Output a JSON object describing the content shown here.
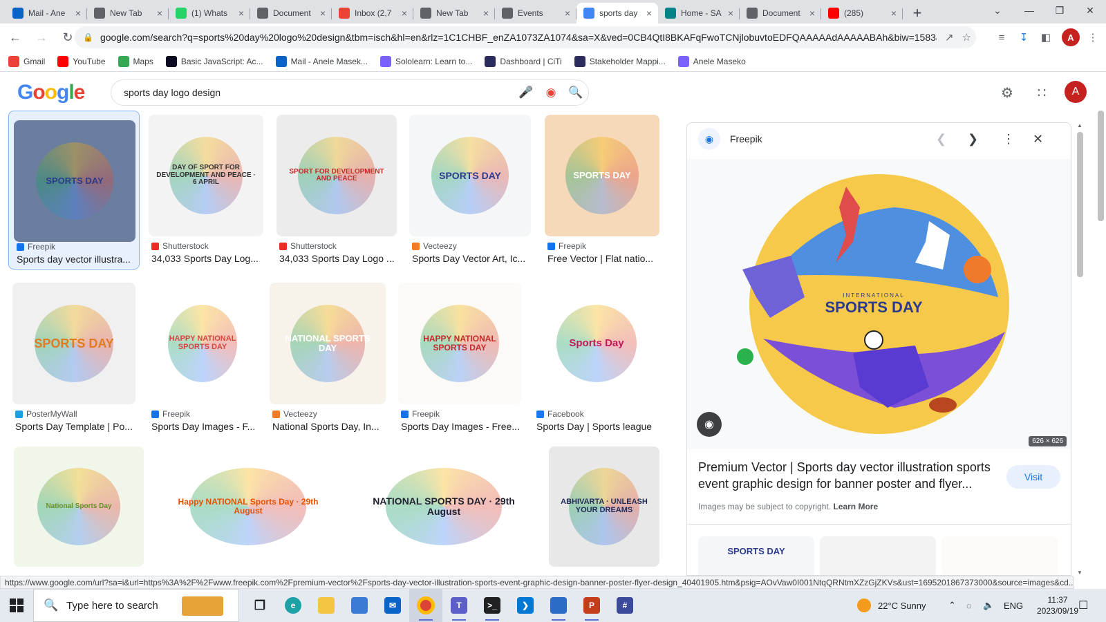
{
  "tabs": [
    {
      "label": "Mail - Ane",
      "icon": "outlook-icon",
      "color": "#0a64c8"
    },
    {
      "label": "New Tab",
      "icon": "chrome-icon",
      "color": "#5f6368"
    },
    {
      "label": "(1) Whats",
      "icon": "whatsapp-icon",
      "color": "#25d366"
    },
    {
      "label": "Document",
      "icon": "globe-icon",
      "color": "#5f6368"
    },
    {
      "label": "Inbox (2,7",
      "icon": "gmail-icon",
      "color": "#ea4335"
    },
    {
      "label": "New Tab",
      "icon": "chrome-icon",
      "color": "#5f6368"
    },
    {
      "label": "Events",
      "icon": "globe-icon",
      "color": "#5f6368"
    },
    {
      "label": "sports day",
      "icon": "google-icon",
      "color": "#4285f4",
      "active": true
    },
    {
      "label": "Home - SA",
      "icon": "sharepoint-icon",
      "color": "#038387"
    },
    {
      "label": "Document",
      "icon": "globe-icon",
      "color": "#5f6368"
    },
    {
      "label": "(285)",
      "icon": "youtube-icon",
      "color": "#ff0000"
    }
  ],
  "address": {
    "url": "google.com/search?q=sports%20day%20logo%20design&tbm=isch&hl=en&rlz=1C1CHBF_enZA1073ZA1074&sa=X&ved=0CB4QtI8BKAFqFwoTCNjlobuvtoEDFQAAAAAdAAAAABAh&biw=1583&..."
  },
  "bookmarks": [
    {
      "label": "Gmail",
      "icon": "gmail-icon",
      "color": "#ea4335"
    },
    {
      "label": "YouTube",
      "icon": "youtube-icon",
      "color": "#ff0000"
    },
    {
      "label": "Maps",
      "icon": "maps-icon",
      "color": "#34a853"
    },
    {
      "label": "Basic JavaScript: Ac...",
      "icon": "freecodecamp-icon",
      "color": "#0a0a23"
    },
    {
      "label": "Mail - Anele Masek...",
      "icon": "outlook-icon",
      "color": "#0a64c8"
    },
    {
      "label": "Sololearn: Learn to...",
      "icon": "sololearn-icon",
      "color": "#7b61ff"
    },
    {
      "label": "Dashboard | CiTi",
      "icon": "citi-icon",
      "color": "#2b2b5e"
    },
    {
      "label": "Stakeholder Mappi...",
      "icon": "doc-icon",
      "color": "#2b2b5e"
    },
    {
      "label": "Anele Maseko",
      "icon": "sololearn-icon",
      "color": "#7b61ff"
    }
  ],
  "search": {
    "query": "sports day logo design"
  },
  "google_logo": [
    "G",
    "o",
    "o",
    "g",
    "l",
    "e"
  ],
  "avatar_letter": "A",
  "results": [
    {
      "source": "Freepik",
      "title": "Sports day vector illustra...",
      "thumb_text": "SPORTS DAY",
      "sfav": "#1273eb",
      "bg": "#6c7ea0"
    },
    {
      "source": "Shutterstock",
      "title": "34,033 Sports Day Log...",
      "thumb_text": "DAY OF SPORT FOR DEVELOPMENT AND PEACE · 6 APRIL",
      "sfav": "#ee2b24",
      "bg": "#f3f3f3"
    },
    {
      "source": "Shutterstock",
      "title": "34,033 Sports Day Logo ...",
      "thumb_text": "SPORT FOR DEVELOPMENT AND PEACE",
      "sfav": "#ee2b24",
      "bg": "#ececec"
    },
    {
      "source": "Vecteezy",
      "title": "Sports Day Vector Art, Ic...",
      "thumb_text": "SPORTS DAY",
      "sfav": "#f47b20",
      "bg": "#f4f6f8"
    },
    {
      "source": "Freepik",
      "title": "Free Vector | Flat natio...",
      "thumb_text": "SPORTS DAY",
      "sfav": "#1273eb",
      "bg": "#f6d9b8"
    },
    {
      "source": "PosterMyWall",
      "title": "Sports Day Template | Po...",
      "thumb_text": "SPORTS DAY",
      "sfav": "#1ba1e2",
      "bg": "#f0f0f0"
    },
    {
      "source": "Freepik",
      "title": "Sports Day Images - F...",
      "thumb_text": "HAPPY NATIONAL SPORTS DAY",
      "sfav": "#1273eb",
      "bg": "#ffffff"
    },
    {
      "source": "Vecteezy",
      "title": "National Sports Day, In...",
      "thumb_text": "NATIONAL SPORTS DAY",
      "sfav": "#f47b20",
      "bg": "#f7f2ea"
    },
    {
      "source": "Freepik",
      "title": "Sports Day Images - Free...",
      "thumb_text": "HAPPY NATIONAL SPORTS DAY",
      "sfav": "#1273eb",
      "bg": "#fbfaf6"
    },
    {
      "source": "Facebook",
      "title": "Sports Day | Sports league",
      "thumb_text": "Sports Day",
      "sfav": "#1877f2",
      "bg": "#ffffff"
    },
    {
      "source": "",
      "title": "",
      "thumb_text": "National Sports Day",
      "sfav": "",
      "bg": "#f1f6ea"
    },
    {
      "source": "",
      "title": "",
      "thumb_text": "Happy NATIONAL Sports Day · 29th August",
      "sfav": "",
      "bg": "#ffffff"
    },
    {
      "source": "",
      "title": "",
      "thumb_text": "NATIONAL SPORTS DAY · 29th August",
      "sfav": "",
      "bg": "#ffffff"
    },
    {
      "source": "",
      "title": "",
      "thumb_text": "ABHIVARTA · UNLEASH YOUR DREAMS",
      "sfav": "",
      "bg": "#e8e8e8"
    }
  ],
  "panel": {
    "source": "Freepik",
    "image_caption_small": "INTERNATIONAL",
    "image_caption": "SPORTS DAY",
    "dimensions": "626 × 626",
    "title": "Premium Vector | Sports day vector illustration sports event graphic design for banner poster and flyer...",
    "visit_label": "Visit",
    "copyright_text": "Images may be subject to copyright.",
    "learn_more": "Learn More",
    "related": [
      {
        "text": "SPORTS DAY"
      },
      {
        "text": ""
      },
      {
        "text": ""
      }
    ]
  },
  "status_url": "https://www.google.com/url?sa=i&url=https%3A%2F%2Fwww.freepik.com%2Fpremium-vector%2Fsports-day-vector-illustration-sports-event-graphic-design-banner-poster-flyer-design_40401905.htm&psig=AOvVaw0I001NtqQRNtmXZzGjZKVs&ust=1695201867373000&source=images&cd...",
  "taskbar": {
    "search_placeholder": "Type here to search",
    "weather": "22°C  Sunny",
    "lang": "ENG",
    "time": "11:37",
    "date": "2023/09/19"
  }
}
